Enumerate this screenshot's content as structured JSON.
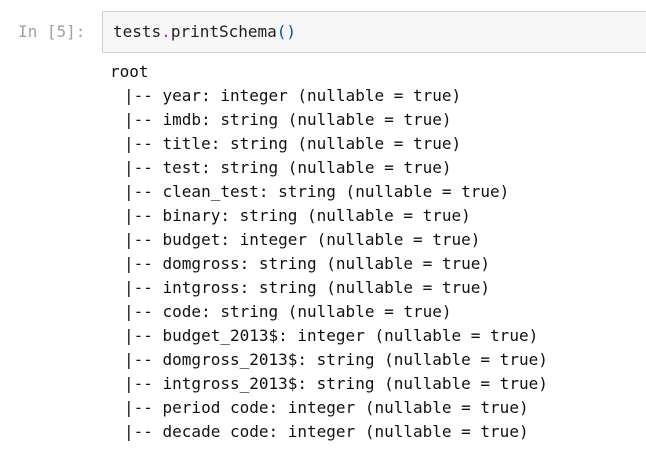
{
  "cell": {
    "prompt": "In [5]:",
    "code": {
      "object": "tests",
      "dot": ".",
      "function": "printSchema",
      "parens": "()"
    }
  },
  "output": {
    "root": "root",
    "fields": [
      "|-- year: integer (nullable = true)",
      "|-- imdb: string (nullable = true)",
      "|-- title: string (nullable = true)",
      "|-- test: string (nullable = true)",
      "|-- clean_test: string (nullable = true)",
      "|-- binary: string (nullable = true)",
      "|-- budget: integer (nullable = true)",
      "|-- domgross: string (nullable = true)",
      "|-- intgross: string (nullable = true)",
      "|-- code: string (nullable = true)",
      "|-- budget_2013$: integer (nullable = true)",
      "|-- domgross_2013$: string (nullable = true)",
      "|-- intgross_2013$: string (nullable = true)",
      "|-- period code: integer (nullable = true)",
      "|-- decade code: integer (nullable = true)"
    ]
  }
}
